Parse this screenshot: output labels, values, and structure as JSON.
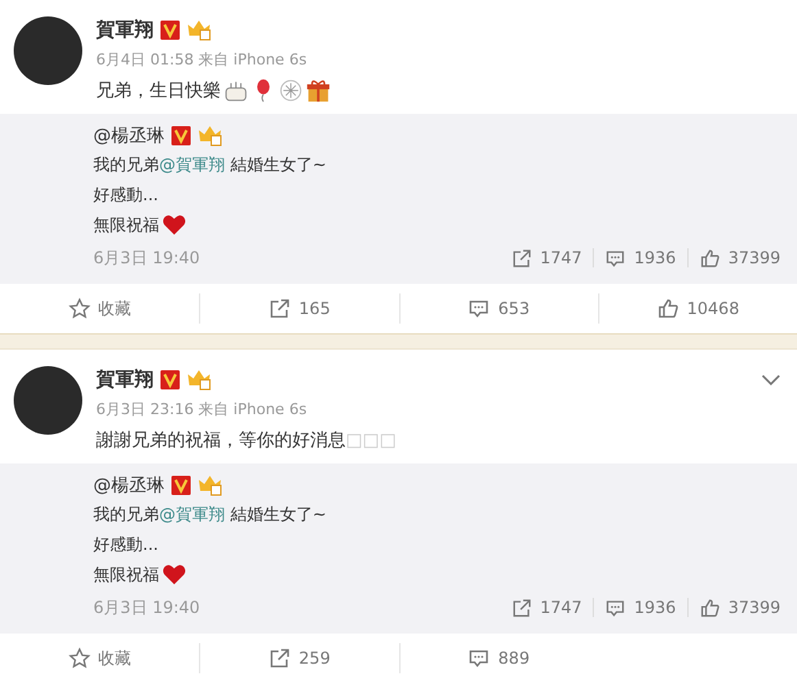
{
  "posts": [
    {
      "author": "賀軍翔",
      "meta": "6月4日 01:58 来自 iPhone 6s",
      "text": "兄弟，生日快樂",
      "emojis": [
        {
          "kind": "cake"
        },
        {
          "kind": "balloon"
        },
        {
          "kind": "fireworks"
        },
        {
          "kind": "gift"
        }
      ],
      "menu": false,
      "quote": {
        "author": "@楊丞琳",
        "lines": [
          {
            "before": "我的兄弟",
            "mention": "@賀軍翔",
            "after": " 結婚生女了~",
            "heart": false
          },
          {
            "before": "好感動...",
            "heart": false
          },
          {
            "before": "無限祝福",
            "heart": true
          }
        ],
        "time": "6月3日 19:40",
        "stats": [
          {
            "kind": "repost",
            "count": "1747"
          },
          {
            "kind": "comment",
            "count": "1936"
          },
          {
            "kind": "like",
            "count": "37399"
          }
        ]
      },
      "actions": [
        {
          "kind": "favorite",
          "label": "收藏"
        },
        {
          "kind": "repost",
          "label": "165"
        },
        {
          "kind": "comment",
          "label": "653"
        },
        {
          "kind": "like",
          "label": "10468"
        }
      ]
    },
    {
      "author": "賀軍翔",
      "meta": "6月3日 23:16 来自 iPhone 6s",
      "text": "謝謝兄弟的祝福，等你的好消息",
      "trailing_glyphs": "□□□",
      "menu": true,
      "quote": {
        "author": "@楊丞琳",
        "lines": [
          {
            "before": "我的兄弟",
            "mention": "@賀軍翔",
            "after": " 結婚生女了~",
            "heart": false
          },
          {
            "before": "好感動...",
            "heart": false
          },
          {
            "before": "無限祝福",
            "heart": true
          }
        ],
        "time": "6月3日 19:40",
        "stats": [
          {
            "kind": "repost",
            "count": "1747"
          },
          {
            "kind": "comment",
            "count": "1936"
          },
          {
            "kind": "like",
            "count": "37399"
          }
        ]
      },
      "actions": [
        {
          "kind": "favorite",
          "label": "收藏"
        },
        {
          "kind": "repost",
          "label": "259"
        },
        {
          "kind": "comment",
          "label": "889"
        }
      ]
    }
  ]
}
